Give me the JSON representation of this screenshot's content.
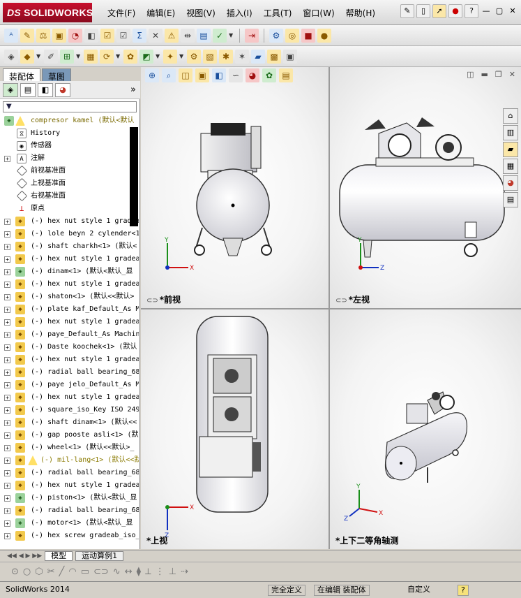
{
  "app": {
    "logo": "SOLIDWORKS",
    "logo_prefix": "DS",
    "menu": [
      "文件(F)",
      "编辑(E)",
      "视图(V)",
      "插入(I)",
      "工具(T)",
      "窗口(W)",
      "帮助(H)"
    ],
    "help_glyph": "?"
  },
  "left_panel": {
    "tabs": [
      "装配体",
      "草图"
    ],
    "tree": [
      {
        "label": "compresor kamel  (默认<默认",
        "type": "root"
      },
      {
        "label": "History",
        "type": "sub"
      },
      {
        "label": "传感器",
        "type": "sub"
      },
      {
        "label": "注解",
        "type": "sub"
      },
      {
        "label": "前视基准面",
        "type": "plane"
      },
      {
        "label": "上视基准面",
        "type": "plane"
      },
      {
        "label": "右视基准面",
        "type": "plane"
      },
      {
        "label": "原点",
        "type": "origin"
      },
      {
        "label": "(-) hex nut style 1 gradea",
        "type": "part"
      },
      {
        "label": "(-) lole beyn 2 cylender<1",
        "type": "part"
      },
      {
        "label": "(-) shaft charkh<1> (默认<",
        "type": "part"
      },
      {
        "label": "(-) hex nut style 1 gradea",
        "type": "part"
      },
      {
        "label": "(-) dinam<1> (默认<默认_显",
        "type": "asm"
      },
      {
        "label": "(-) hex nut style 1 gradea",
        "type": "part"
      },
      {
        "label": "(-) shaton<1> (默认<<默认>",
        "type": "part"
      },
      {
        "label": "(-) plate kaf_Default_As M",
        "type": "part"
      },
      {
        "label": "(-) hex nut style 1 gradea",
        "type": "part"
      },
      {
        "label": "(-) paye_Default_As Machin",
        "type": "part"
      },
      {
        "label": "(-) Daste koochek<1> (默认",
        "type": "part"
      },
      {
        "label": "(-) hex nut style 1 gradea",
        "type": "part"
      },
      {
        "label": "(-) radial ball bearing_68",
        "type": "part"
      },
      {
        "label": "(-) paye jelo_Default_As M",
        "type": "part"
      },
      {
        "label": "(-) hex nut style 1 gradea",
        "type": "part"
      },
      {
        "label": "(-) square_iso_Key ISO 249",
        "type": "part"
      },
      {
        "label": "(-) shaft dinam<1> (默认<<",
        "type": "part"
      },
      {
        "label": "(-) gap pooste asli<1> (默认",
        "type": "part"
      },
      {
        "label": "(-) wheel<1> (默认<<默认>_",
        "type": "part"
      },
      {
        "label": "(-) mil-lang<1> (默认<<默认",
        "type": "warn"
      },
      {
        "label": "(-) radial ball bearing_68",
        "type": "part"
      },
      {
        "label": "(-) hex nut style 1 gradea",
        "type": "part"
      },
      {
        "label": "(-) piston<1> (默认<默认_显",
        "type": "asm"
      },
      {
        "label": "(-) radial ball bearing_68",
        "type": "part"
      },
      {
        "label": "(-) motor<1> (默认<默认_显",
        "type": "asm"
      },
      {
        "label": "(-) hex screw gradeab_iso_",
        "type": "part"
      }
    ]
  },
  "viewports": {
    "front": "*前视",
    "left": "*左视",
    "top": "*上视",
    "iso": "*上下二等角轴测"
  },
  "axes": {
    "x": "X",
    "y": "Y",
    "z": "Z"
  },
  "bottom_tabs": [
    "模型",
    "运动算例1"
  ],
  "status": {
    "app": "SolidWorks 2014",
    "constraint": "完全定义",
    "mode": "在编辑 装配体",
    "units": "自定义",
    "help": "?"
  },
  "colors": {
    "accent": "#c8102e",
    "viewport_bg": "#ffffff",
    "part_icon": "#f2c94c"
  }
}
